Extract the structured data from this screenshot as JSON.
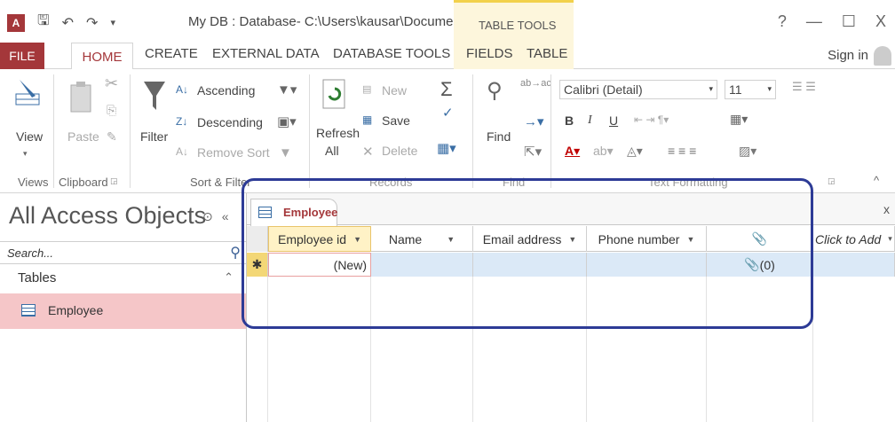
{
  "window": {
    "title": "My DB : Database- C:\\Users\\kausar\\Documents\\...",
    "context_tab_group": "TABLE TOOLS",
    "help": "?",
    "minimize": "—",
    "maximize": "☐",
    "close": "X",
    "app_logo": "A"
  },
  "tabs": {
    "file": "FILE",
    "home": "HOME",
    "create": "CREATE",
    "external": "EXTERNAL DATA",
    "dbtools": "DATABASE TOOLS",
    "fields": "FIELDS",
    "table": "TABLE",
    "signin": "Sign in"
  },
  "ribbon": {
    "views": {
      "view": "View",
      "group": "Views"
    },
    "clipboard": {
      "paste": "Paste",
      "group": "Clipboard"
    },
    "sortfilter": {
      "filter": "Filter",
      "ascending": "Ascending",
      "descending": "Descending",
      "remove_sort": "Remove Sort",
      "group": "Sort & Filter"
    },
    "records": {
      "refresh": "Refresh",
      "refresh_all": "All",
      "new": "New",
      "save": "Save",
      "delete": "Delete",
      "group": "Records"
    },
    "find": {
      "find": "Find",
      "group": "Find"
    },
    "text": {
      "font": "Calibri (Detail)",
      "size": "11",
      "bold": "B",
      "italic": "I",
      "underline": "U",
      "group": "Text Formatting"
    }
  },
  "nav": {
    "title": "All Access Objects",
    "search_placeholder": "Search...",
    "section": "Tables",
    "items": [
      {
        "label": "Employee"
      }
    ]
  },
  "doc": {
    "tab_label": "Employee",
    "close": "x",
    "columns": [
      {
        "label": "Employee id"
      },
      {
        "label": "Name"
      },
      {
        "label": "Email address"
      },
      {
        "label": "Phone number"
      },
      {
        "label": ""
      },
      {
        "label": "Click to Add"
      }
    ],
    "new_row": {
      "marker": "✱",
      "employee_id": "(New)",
      "attachment": "(0)"
    }
  },
  "colors": {
    "accent": "#a4373a",
    "table_tools": "#fdf6dc",
    "highlight_outline": "#2d3b96",
    "selected_nav": "#f5c6c8"
  }
}
